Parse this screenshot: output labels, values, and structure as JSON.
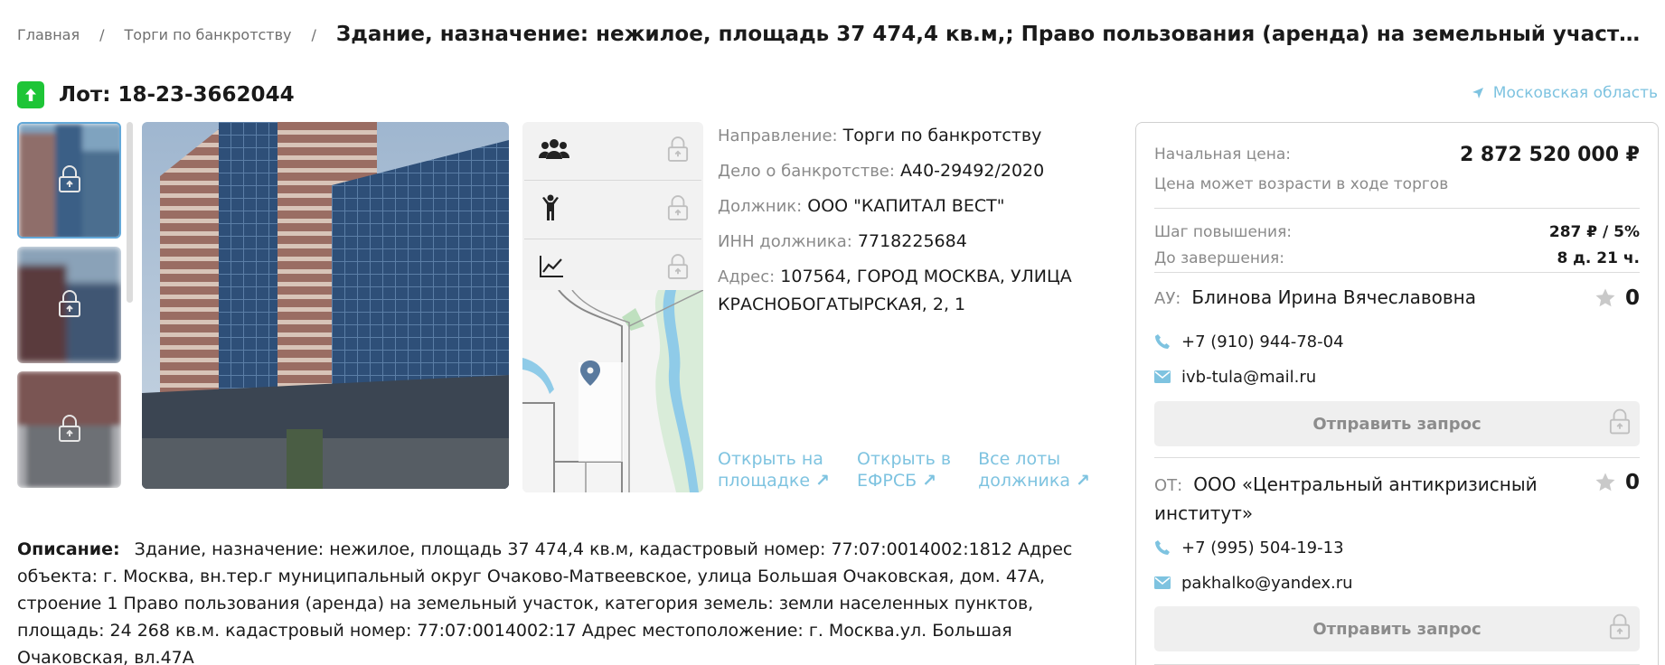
{
  "breadcrumb": {
    "home": "Главная",
    "section": "Торги по банкротству",
    "separator": "/",
    "current": "Здание, назначение: нежилое, площадь 37 474,4 кв.м,; Право пользования (аренда) на земельный участок, категория..."
  },
  "lot": {
    "title": "Лот: 18-23-3662044"
  },
  "region": "Московская область",
  "info": {
    "direction_label": "Направление:",
    "direction": "Торги по банкротству",
    "case_label": "Дело о банкротстве:",
    "case": "А40-29492/2020",
    "debtor_label": "Должник:",
    "debtor": "ООО \"КАПИТАЛ ВЕСТ\"",
    "inn_label": "ИНН должника:",
    "inn": "7718225684",
    "address_label": "Адрес:",
    "address": "107564, ГОРОД МОСКВА, УЛИЦА КРАСНОБОГАТЫРСКАЯ, 2, 1"
  },
  "links": {
    "platform_1": "Открыть на",
    "platform_2": "площадке",
    "efrsb_1": "Открыть в",
    "efrsb_2": "ЕФРСБ",
    "debtor_lots_1": "Все лоты",
    "debtor_lots_2": "должника",
    "arrow": "↗"
  },
  "description": {
    "label": "Описание:",
    "text": "Здание, назначение: нежилое, площадь 37 474,4 кв.м, кадастровый номер: 77:07:0014002:1812 Адрес объекта: г. Москва, вн.тер.г муниципальный округ Очаково-Матвеевское, улица Большая Очаковская, дом. 47А, строение 1 Право пользования (аренда) на земельный участок, категория земель: земли населенных пунктов, площадь: 24 268 кв.м. кадастровый номер: 77:07:0014002:17 Адрес местоположение: г. Москва.ул. Большая Очаковская, вл.47А"
  },
  "price": {
    "start_label": "Начальная цена:",
    "start_value": "2 872 520 000 ₽",
    "note": "Цена может возрасти в ходе торгов",
    "step_label": "Шаг повышения:",
    "step_value": "287 ₽  /  5%",
    "end_label": "До завершения:",
    "end_value": "8 д. 21 ч."
  },
  "au": {
    "label": "АУ:",
    "name": "Блинова Ирина Вячеславовна",
    "rating": "0",
    "phone": "+7 (910) 944-78-04",
    "email": "ivb-tula@mail.ru",
    "button": "Отправить запрос"
  },
  "ot": {
    "label": "ОТ:",
    "name": "ООО «Центральный антикризисный институт»",
    "rating": "0",
    "phone": "+7 (995) 504-19-13",
    "email": "pakhalko@yandex.ru",
    "button": "Отправить запрос"
  },
  "icons": {
    "lot_up": "arrow-up-icon",
    "region": "location-arrow-icon",
    "participants": "users-icon",
    "person": "person-icon",
    "chart": "chart-icon",
    "lock": "lock-icon",
    "map_pin": "map-pin-icon",
    "phone": "phone-icon",
    "email": "envelope-icon",
    "star": "star-icon"
  },
  "colors": {
    "accent": "#7ec3e0",
    "lot_badge": "#1ec537",
    "muted": "#8a8a8a"
  }
}
